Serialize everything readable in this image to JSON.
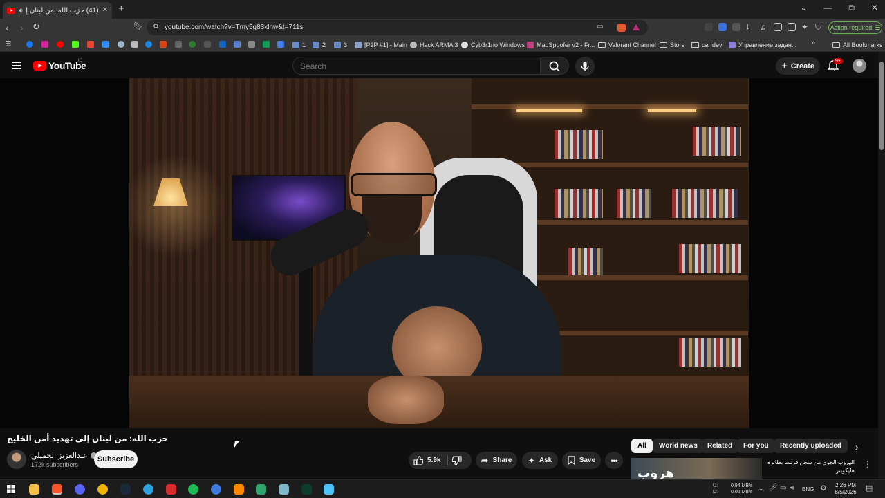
{
  "browser": {
    "tab_title": "(41) حزب الله: من لبنان إلى تهد",
    "new_tab": "+",
    "url": "youtube.com/watch?v=Tmy5g83klhw&t=711s",
    "action_required": "Action required",
    "window_controls": [
      "⌄",
      "—",
      "⧉",
      "✕"
    ]
  },
  "bookmarks": {
    "items": [
      {
        "label": "1",
        "color": "#6b8ec7"
      },
      {
        "label": "2",
        "color": "#6b8ec7"
      },
      {
        "label": "3",
        "color": "#6b8ec7"
      },
      {
        "label": "[P2P #1] - Main",
        "color": "#8aa0c8"
      },
      {
        "label": "Hack ARMA 3",
        "color": "#bbbbbb"
      },
      {
        "label": "Cyb3r1no Windows",
        "color": "#dddddd"
      },
      {
        "label": "MadSpoofer v2 - Fr...",
        "color": "#c04080"
      }
    ],
    "folders": [
      "Valorant Channel",
      "Store",
      "car dev"
    ],
    "russian": "Управление задан...",
    "more": "»",
    "all_bookmarks": "All Bookmarks"
  },
  "youtube": {
    "wordmark": "YouTube",
    "country": "IQ",
    "search_placeholder": "Search",
    "create_label": "Create",
    "notification_badge": "9+"
  },
  "video": {
    "title": "حزب الله: من لبنان إلى تهديد أمن الخليج",
    "channel_name": "عبدالعزيز الخميلي",
    "subscribers": "172k subscribers",
    "subscribe_label": "Subscribe",
    "likes": "5.9k",
    "share_label": "Share",
    "ask_label": "Ask",
    "save_label": "Save"
  },
  "chips": {
    "items": [
      "All",
      "World news",
      "Related",
      "For you",
      "Recently uploaded"
    ],
    "active": "All"
  },
  "recommendation": {
    "thumb_text": "هروب",
    "title": "الهروب الجوي من سجن فرنسا بطائرة هليكوبتر"
  },
  "taskbar": {
    "net_labels": "U:\nD:",
    "net_up": "0.94 MB/s",
    "net_down": "0.02 MB/s",
    "language": "ENG",
    "time": "2:26 PM",
    "date": "8/5/2026"
  },
  "colors": {
    "youtube_red": "#ff0000",
    "action_green": "#6ab04c"
  }
}
